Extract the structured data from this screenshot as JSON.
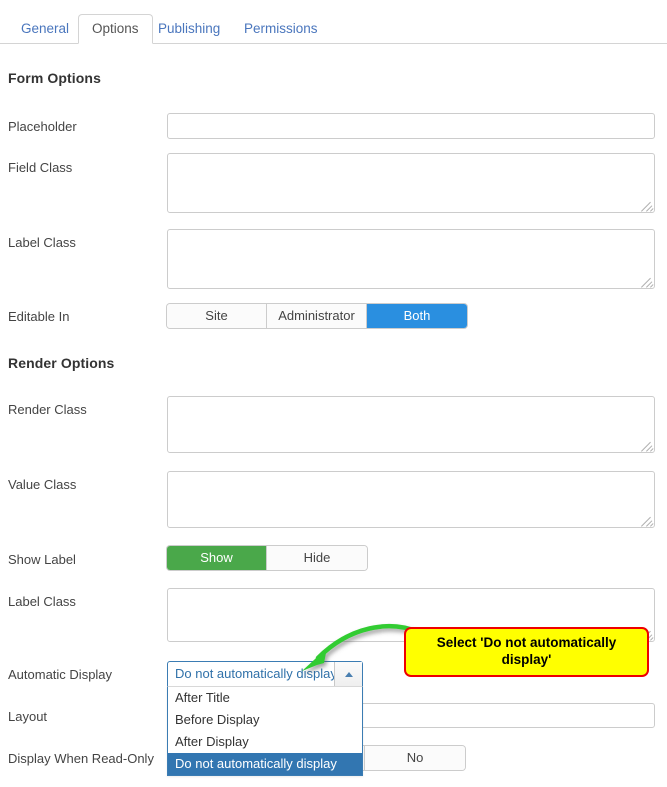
{
  "tabs": [
    {
      "label": "General",
      "active": false
    },
    {
      "label": "Options",
      "active": true
    },
    {
      "label": "Publishing",
      "active": false
    },
    {
      "label": "Permissions",
      "active": false
    }
  ],
  "sections": {
    "form_options_title": "Form Options",
    "render_options_title": "Render Options"
  },
  "form_options": {
    "placeholder_label": "Placeholder",
    "placeholder_value": "",
    "field_class_label": "Field Class",
    "field_class_value": "",
    "label_class_label": "Label Class",
    "label_class_value": "",
    "editable_in_label": "Editable In",
    "editable_in_options": [
      "Site",
      "Administrator",
      "Both"
    ],
    "editable_in_selected": "Both"
  },
  "render_options": {
    "render_class_label": "Render Class",
    "render_class_value": "",
    "value_class_label": "Value Class",
    "value_class_value": "",
    "show_label_label": "Show Label",
    "show_label_options": [
      "Show",
      "Hide"
    ],
    "show_label_selected": "Show",
    "label_class_label": "Label Class",
    "label_class_value": "",
    "automatic_display_label": "Automatic Display",
    "layout_label": "Layout",
    "display_when_read_only_label": "Display When Read-Only",
    "display_when_read_only_value": "No"
  },
  "automatic_display_select": {
    "selected": "Do not automatically display",
    "expanded": true,
    "arrow_icon": "chevron-up-icon",
    "options": [
      {
        "label": "After Title",
        "selected": false
      },
      {
        "label": "Before Display",
        "selected": false
      },
      {
        "label": "After Display",
        "selected": false
      },
      {
        "label": "Do not automatically display",
        "selected": true
      }
    ]
  },
  "annotation": {
    "text": "Select 'Do not automatically display'",
    "box_fill": "#ffff00",
    "box_border": "#ee0000",
    "arrow_color": "#33cc33"
  },
  "colors": {
    "tab_link": "#4a76bd",
    "active_blue": "#2a8fe0",
    "active_green": "#4aa84a",
    "select_highlight": "#3276b1",
    "select_border": "#3b7cb3"
  }
}
